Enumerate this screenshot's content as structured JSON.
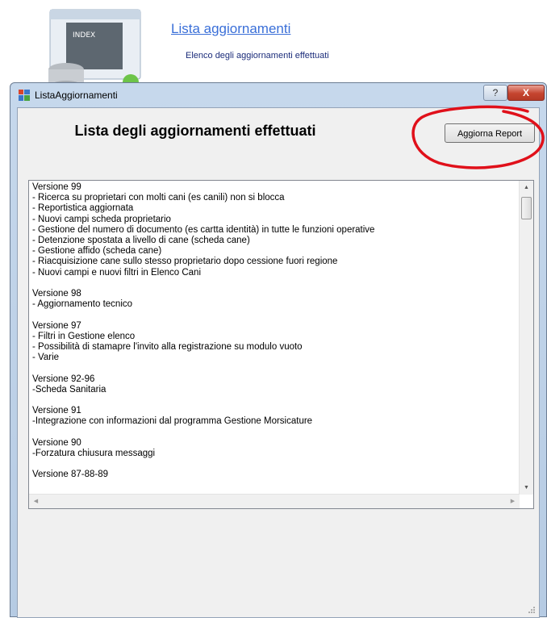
{
  "background": {
    "title": "Lista aggiornamenti",
    "description": "Elenco degli aggiornamenti effettuati",
    "icon_label": "INDEX"
  },
  "window": {
    "title": "ListaAggiornamenti",
    "help_label": "?",
    "close_label": "X"
  },
  "main": {
    "heading": "Lista degli aggiornamenti effettuati",
    "report_button": "Aggiorna Report",
    "content": "Versione 99\n- Ricerca su proprietari con molti cani (es canili) non si blocca\n- Reportistica aggiornata\n- Nuovi campi scheda proprietario\n- Gestione del numero di documento (es cartta identità) in tutte le funzioni operative\n- Detenzione spostata a livello di cane (scheda cane)\n- Gestione affido (scheda cane)\n- Riacquisizione cane sullo stesso proprietario dopo cessione fuori regione\n- Nuovi campi e nuovi filtri in Elenco Cani\n\nVersione 98\n- Aggiornamento tecnico\n\nVersione 97\n- Filtri in Gestione elenco\n- Possibilità di stamapre l'invito alla registrazione su modulo vuoto\n- Varie\n\nVersione 92-96\n-Scheda Sanitaria\n\nVersione 91\n-Integrazione con informazioni dal programma Gestione Morsicature\n\nVersione 90\n-Forzatura chiusura messaggi\n\nVersione 87-88-89"
  },
  "colors": {
    "annotation": "#e0101a",
    "link": "#3a6fd8",
    "close": "#c5442f"
  }
}
